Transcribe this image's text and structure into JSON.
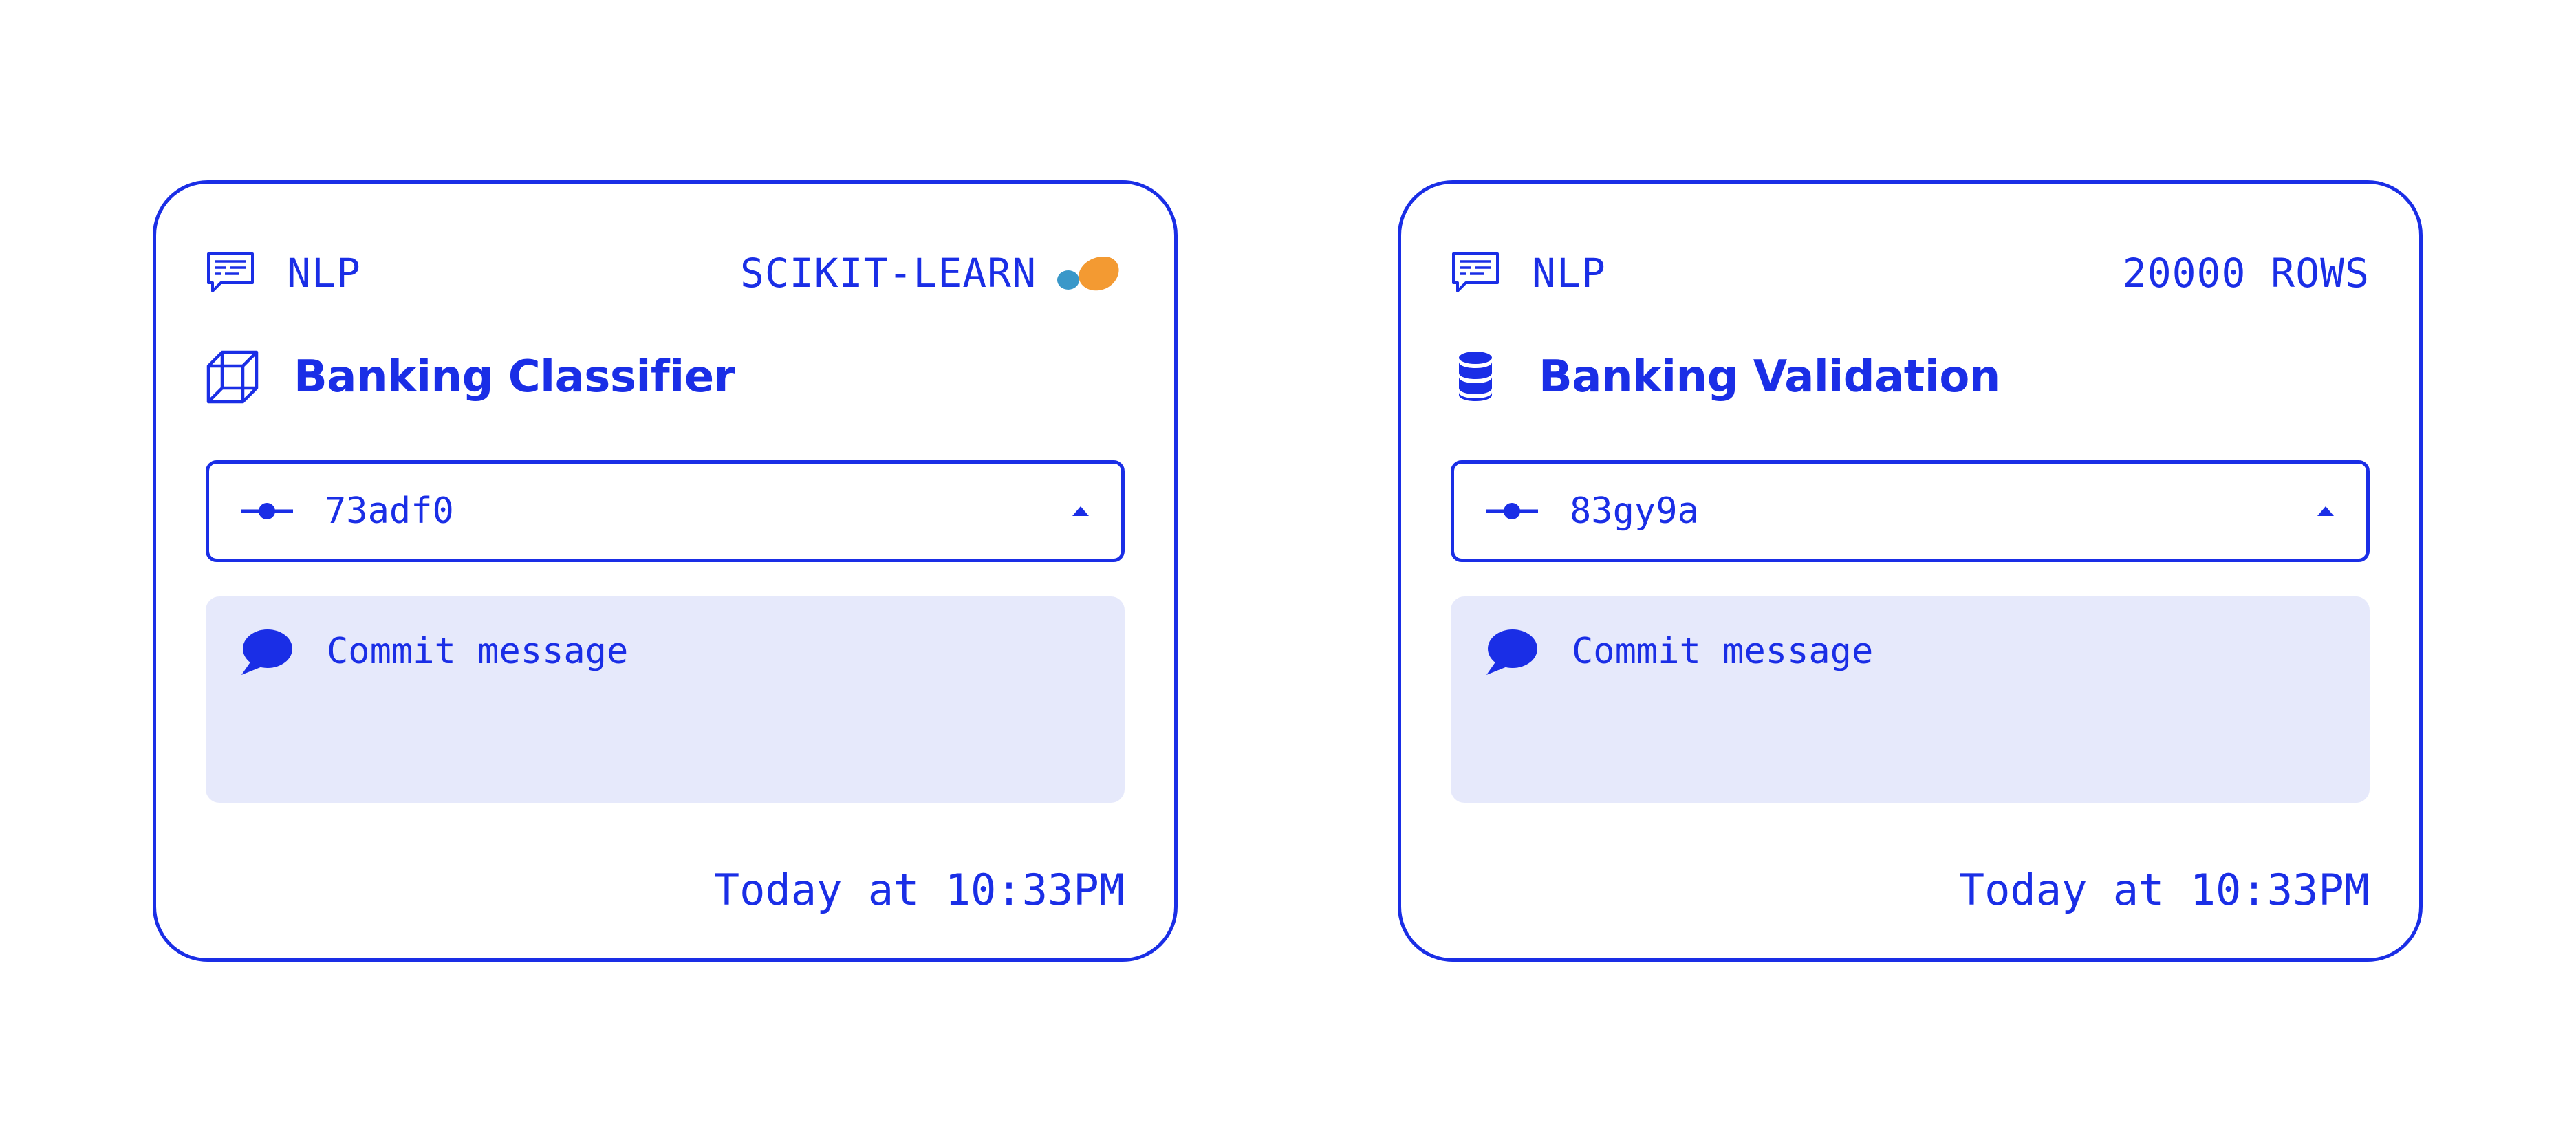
{
  "colors": {
    "accent": "#1a2ee6",
    "message_bg": "#e6e9fb",
    "logo_orange": "#f39a32",
    "logo_blue": "#3a98c9"
  },
  "cards": [
    {
      "category_icon": "chat-lines-icon",
      "category": "NLP",
      "meta": "SCIKIT-LEARN",
      "meta_icon": "scikit-learn-logo",
      "type_icon": "cube-model-icon",
      "title": "Banking Classifier",
      "commit": {
        "icon": "commit-icon",
        "value": "73adf0",
        "caret_icon": "caret-up-icon"
      },
      "message": {
        "icon": "speech-bubble-icon",
        "placeholder": "Commit message"
      },
      "timestamp": "Today at 10:33PM"
    },
    {
      "category_icon": "chat-lines-icon",
      "category": "NLP",
      "meta": "20000 ROWS",
      "type_icon": "database-icon",
      "title": "Banking Validation",
      "commit": {
        "icon": "commit-icon",
        "value": "83gy9a",
        "caret_icon": "caret-up-icon"
      },
      "message": {
        "icon": "speech-bubble-icon",
        "placeholder": "Commit message"
      },
      "timestamp": "Today at 10:33PM"
    }
  ]
}
